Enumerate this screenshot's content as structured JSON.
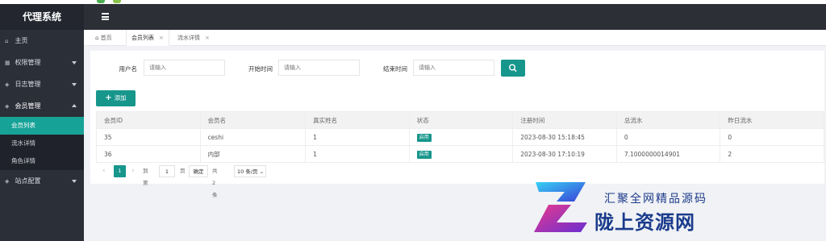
{
  "colors": {
    "accent": "#17968c",
    "sidebar": "#2b2f38",
    "topbar": "#2c2f35",
    "watermark": "#1d3a8a"
  },
  "sidebar": {
    "title": "代理系统",
    "items": [
      {
        "label": "主页",
        "icon": "home-icon"
      },
      {
        "label": "权限管理",
        "icon": "grid-icon"
      },
      {
        "label": "日志管理",
        "icon": "layers-icon"
      },
      {
        "label": "会员管理",
        "icon": "layers-icon"
      },
      {
        "label": "站点配置",
        "icon": "layers-icon"
      }
    ],
    "sub_items": [
      {
        "label": "会员列表"
      },
      {
        "label": "流水详情"
      },
      {
        "label": "角色详情"
      }
    ]
  },
  "tabs": [
    {
      "label": "首页"
    },
    {
      "label": "会员列表"
    },
    {
      "label": "流水详情"
    }
  ],
  "filters": {
    "username_label": "用户名",
    "start_label": "开始时间",
    "end_label": "结束时间",
    "placeholder": "请输入"
  },
  "actions": {
    "add_label": "添加"
  },
  "table": {
    "headers": [
      "会员ID",
      "会员名",
      "真实姓名",
      "状态",
      "注册时间",
      "总流水",
      "昨日流水"
    ],
    "rows": [
      {
        "id": "35",
        "name": "ceshi",
        "real_name": "1",
        "status": "启用",
        "reg_time": "2023-08-30 15:18:45",
        "total": "0",
        "yesterday": "0"
      },
      {
        "id": "36",
        "name": "内部",
        "real_name": "1",
        "status": "启用",
        "reg_time": "2023-08-30 17:10:19",
        "total": "7.1000000014901",
        "yesterday": "2"
      }
    ]
  },
  "pagination": {
    "current": "1",
    "goto_label": "到第",
    "page_input": "1",
    "page_unit": "页",
    "confirm_label": "确定",
    "total_label": "共 2 条",
    "per_page": "10 条/页"
  },
  "watermark": {
    "line1": "汇聚全网精品源码",
    "line2": "陇上资源网"
  }
}
